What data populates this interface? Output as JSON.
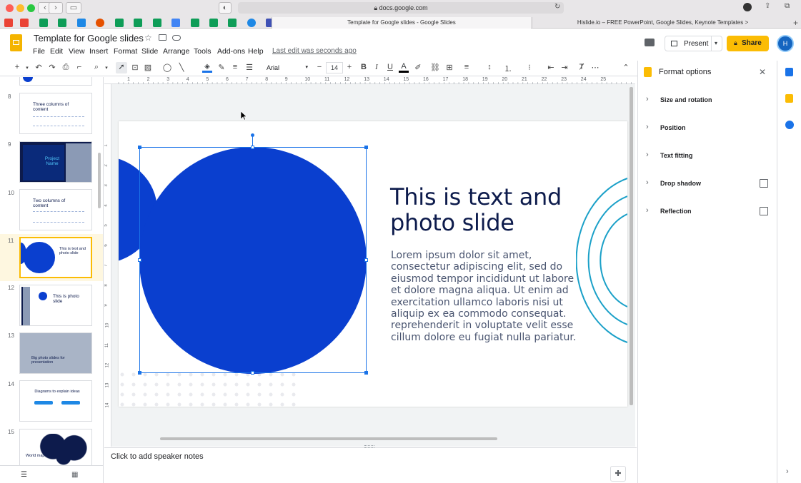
{
  "browser": {
    "url": "docs.google.com",
    "tabs": [
      "Template for Google slides - Google Slides",
      "Hislide.io – FREE PowerPoint, Google Slides, Keynote Templates >"
    ]
  },
  "header": {
    "title": "Template for Google slides",
    "menus": [
      "File",
      "Edit",
      "View",
      "Insert",
      "Format",
      "Slide",
      "Arrange",
      "Tools",
      "Add-ons",
      "Help"
    ],
    "last_edit": "Last edit was seconds ago",
    "present_label": "Present",
    "share_label": "Share",
    "avatar_initial": "H"
  },
  "toolbar": {
    "font": "Arial",
    "font_size": "14",
    "ruler_marks": [
      "1",
      "2",
      "3",
      "4",
      "5",
      "6",
      "7",
      "8",
      "9",
      "10",
      "11",
      "12",
      "13",
      "14",
      "15",
      "16",
      "17",
      "18",
      "19",
      "20",
      "21",
      "22",
      "23",
      "24",
      "25"
    ],
    "vruler_marks": [
      "1",
      "2",
      "3",
      "4",
      "5",
      "6",
      "7",
      "8",
      "9",
      "10",
      "11",
      "12",
      "13",
      "14"
    ]
  },
  "filmstrip": {
    "slides": [
      {
        "num": "8",
        "title": "Three columns of content"
      },
      {
        "num": "9",
        "title": "Project Name"
      },
      {
        "num": "10",
        "title": "Two columns of content"
      },
      {
        "num": "11",
        "title": "This is text and photo slide"
      },
      {
        "num": "12",
        "title": "This is photo slide"
      },
      {
        "num": "13",
        "title": "Big photo slides for presentation"
      },
      {
        "num": "14",
        "title": "Diagrams to explain ideas"
      },
      {
        "num": "15",
        "title": "World map"
      }
    ]
  },
  "slide": {
    "heading": "This is text and photo slide",
    "heading_line1": "This is text and",
    "heading_line2": "photo slide",
    "body_lines": [
      "Lorem ipsum dolor sit amet,",
      "consectetur adipiscing elit, sed do",
      "eiusmod tempor incididunt ut labore",
      "et dolore magna aliqua. Ut enim ad",
      "exercitation ullamco laboris nisi ut",
      "aliquip ex ea commodo consequat.",
      "reprehenderit in voluptate velit esse",
      "cillum dolore eu fugiat nulla pariatur."
    ]
  },
  "notes": {
    "placeholder": "Click to add speaker notes"
  },
  "format_panel": {
    "title": "Format options",
    "sections": [
      "Size and rotation",
      "Position",
      "Text fitting",
      "Drop shadow",
      "Reflection"
    ]
  },
  "colors": {
    "accent_blue": "#0a3fcf",
    "dark_navy": "#0d1b4c",
    "teal_arc": "#1aa0c8",
    "share_yellow": "#fbbc04",
    "selection": "#1a73e8"
  }
}
